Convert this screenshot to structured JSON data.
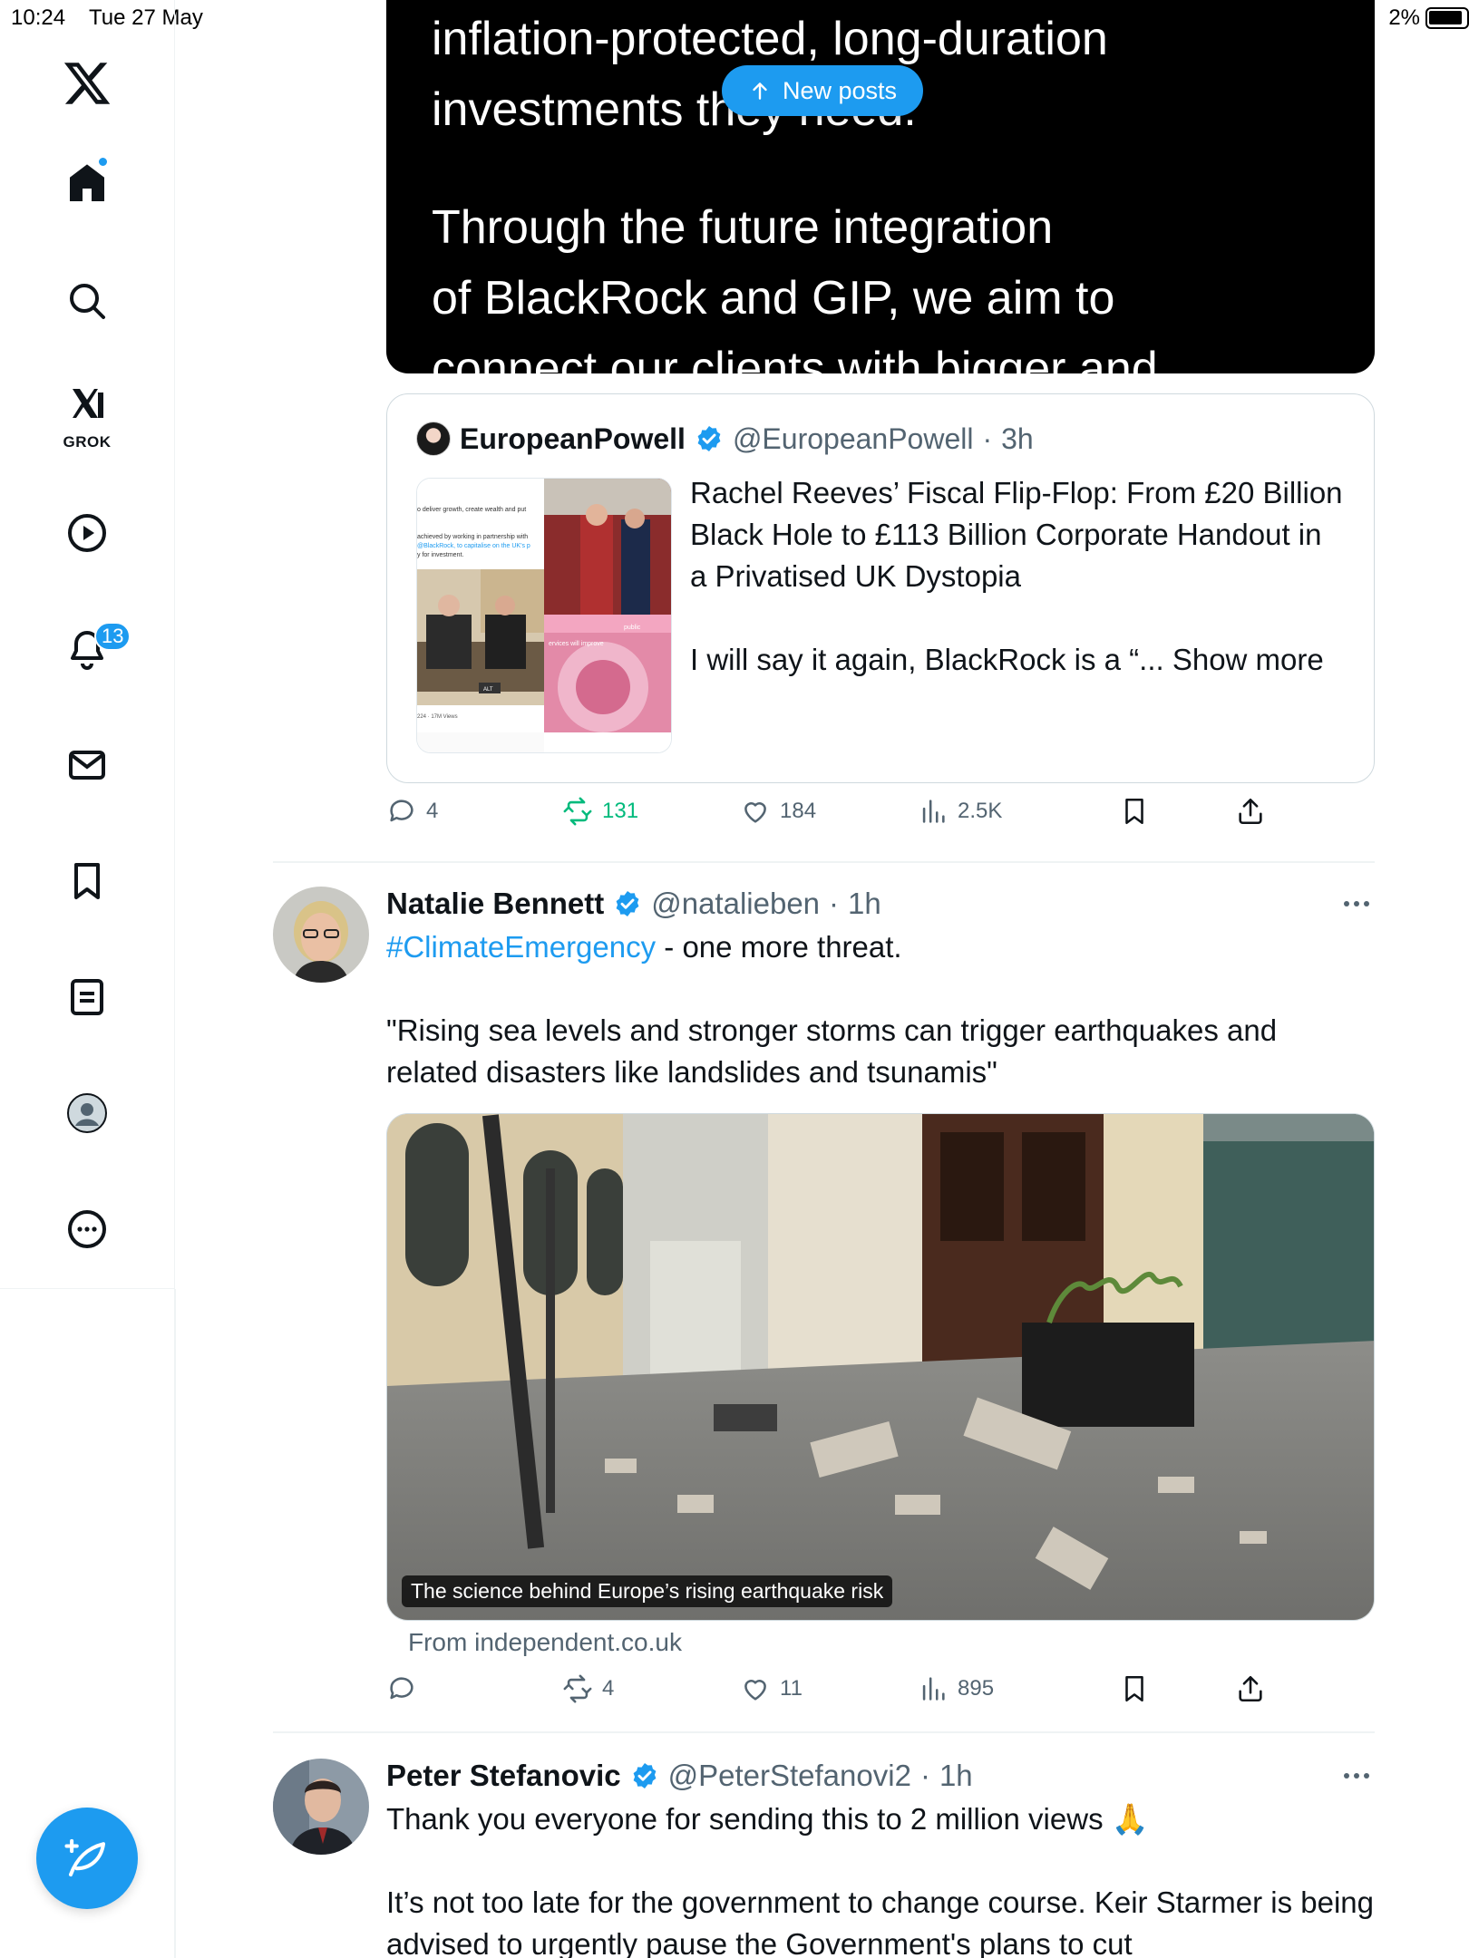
{
  "status_bar": {
    "time": "10:24",
    "date": "Tue 27 May",
    "battery": "2%"
  },
  "sidebar": {
    "grok_label": "GROK",
    "notification_count": "13"
  },
  "video": {
    "lines": [
      "inflation-protected, long-duration",
      "investments they need.",
      "Through the future integration",
      "of BlackRock and GIP, we aim to",
      "connect our clients with bigger and"
    ]
  },
  "new_posts_label": "New posts",
  "quote": {
    "name": "EuropeanPowell",
    "handle": "@EuropeanPowell",
    "time": "3h",
    "text1": "Rachel Reeves’ Fiscal Flip-Flop: From £20 Billion Black Hole to £113 Billion Corporate Handout in a Privatised UK Dystopia",
    "text2": "I will say it again, BlackRock is a “... Show more",
    "thumb_lines": [
      "o deliver growth, create wealth and put",
      "achieved by working in partnership with",
      "@BlackRock, to capitalise on the UK's p",
      "y for investment.",
      "ALT",
      "public",
      "ervices will improve",
      "224 · 17M Views"
    ]
  },
  "post1_actions": {
    "replies": "4",
    "reposts": "131",
    "likes": "184",
    "views": "2.5K"
  },
  "post2": {
    "name": "Natalie Bennett",
    "handle": "@natalieben",
    "time": "1h",
    "hashtag": "#ClimateEmergency",
    "text_after_hashtag": " - one more threat.",
    "quote_text": "\"Rising sea levels and stronger storms can trigger earthquakes and related disasters like landslides and tsunamis\"",
    "media_caption": "The science behind Europe’s rising earthquake risk",
    "media_source": "From independent.co.uk",
    "actions": {
      "replies": "",
      "reposts": "4",
      "likes": "11",
      "views": "895"
    }
  },
  "post3": {
    "name": "Peter Stefanovic",
    "handle": "@PeterStefanovi2",
    "time": "1h",
    "text1": "Thank you everyone for sending this to 2 million views 🙏",
    "text2": "It’s not too late for the government to change course. Keir Starmer is being advised to urgently pause the Government's plans to cut"
  },
  "colors": {
    "accent": "#1d9bf0",
    "repost_green": "#00ba7c",
    "muted": "#536471",
    "text": "#0f1419"
  }
}
